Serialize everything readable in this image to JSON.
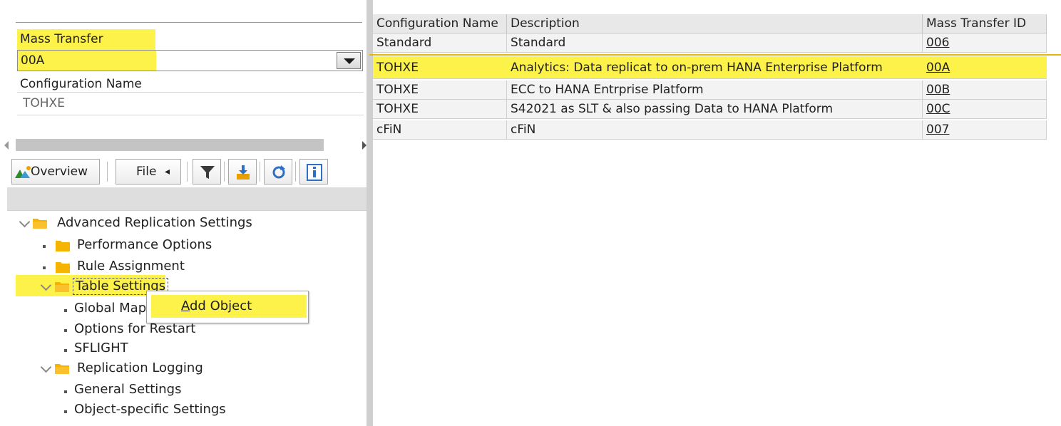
{
  "left": {
    "mass_transfer_label": "Mass Transfer",
    "mass_transfer_value": "00A",
    "config_name_label": "Configuration Name",
    "config_name_value": "TOHXE",
    "toolbar": {
      "overview_label": "Overview",
      "file_label": "File",
      "file_arrow": "◂",
      "icons": [
        "filter-icon",
        "download-icon",
        "refresh-icon",
        "info-icon"
      ]
    },
    "tree": {
      "advanced": "Advanced Replication Settings",
      "performance": "Performance Options",
      "rule": "Rule Assignment",
      "table": "Table Settings",
      "global": "Global Mapp",
      "restart": "Options for Restart",
      "sflight": "SFLIGHT",
      "logging": "Replication Logging",
      "general": "General Settings",
      "object": "Object-specific Settings"
    },
    "context_menu": {
      "add_object_mnemonic": "A",
      "add_object_rest": "dd Object"
    }
  },
  "grid": {
    "columns": [
      "Configuration Name",
      "Description",
      "Mass Transfer ID"
    ],
    "rows": [
      {
        "name": "Standard",
        "desc": "Standard",
        "id": "006"
      },
      {
        "name": "TOHXE",
        "desc": "Analytics: Data replicat to on-prem HANA Enterprise Platform",
        "id": "00A"
      },
      {
        "name": "TOHXE",
        "desc": "ECC to HANA Entrprise Platform",
        "id": "00B"
      },
      {
        "name": "TOHXE",
        "desc": "S42021 as SLT & also passing Data to HANA Platform",
        "id": "00C"
      },
      {
        "name": "cFiN",
        "desc": "cFiN",
        "id": "007"
      }
    ],
    "selected_row": 1
  },
  "colors": {
    "highlight": "#fdf24a",
    "folder": "#f4b400",
    "header_bg": "#e8e8e8",
    "row_bg": "#f3f3f3"
  }
}
